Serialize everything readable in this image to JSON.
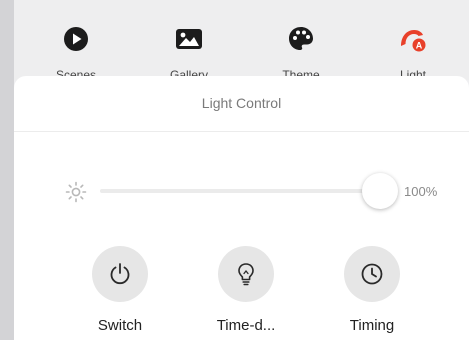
{
  "tabs": [
    {
      "icon": "play-circle-icon",
      "label": "Scenes"
    },
    {
      "icon": "image-icon",
      "label": "Gallery"
    },
    {
      "icon": "palette-icon",
      "label": "Theme"
    },
    {
      "icon": "scene-flag-icon",
      "label": "Light",
      "active": true,
      "color": "#e8402a"
    }
  ],
  "sheet": {
    "title": "Light Control"
  },
  "brightness": {
    "icon": "brightness-sun-icon",
    "value": 1.0,
    "label": "100%"
  },
  "actions": [
    {
      "icon": "power-icon",
      "label": "Switch"
    },
    {
      "icon": "bulb-icon",
      "label": "Time-d..."
    },
    {
      "icon": "clock-icon",
      "label": "Timing"
    }
  ],
  "colors": {
    "accent": "#e8402a",
    "icon_dark": "#1c1c1c"
  }
}
